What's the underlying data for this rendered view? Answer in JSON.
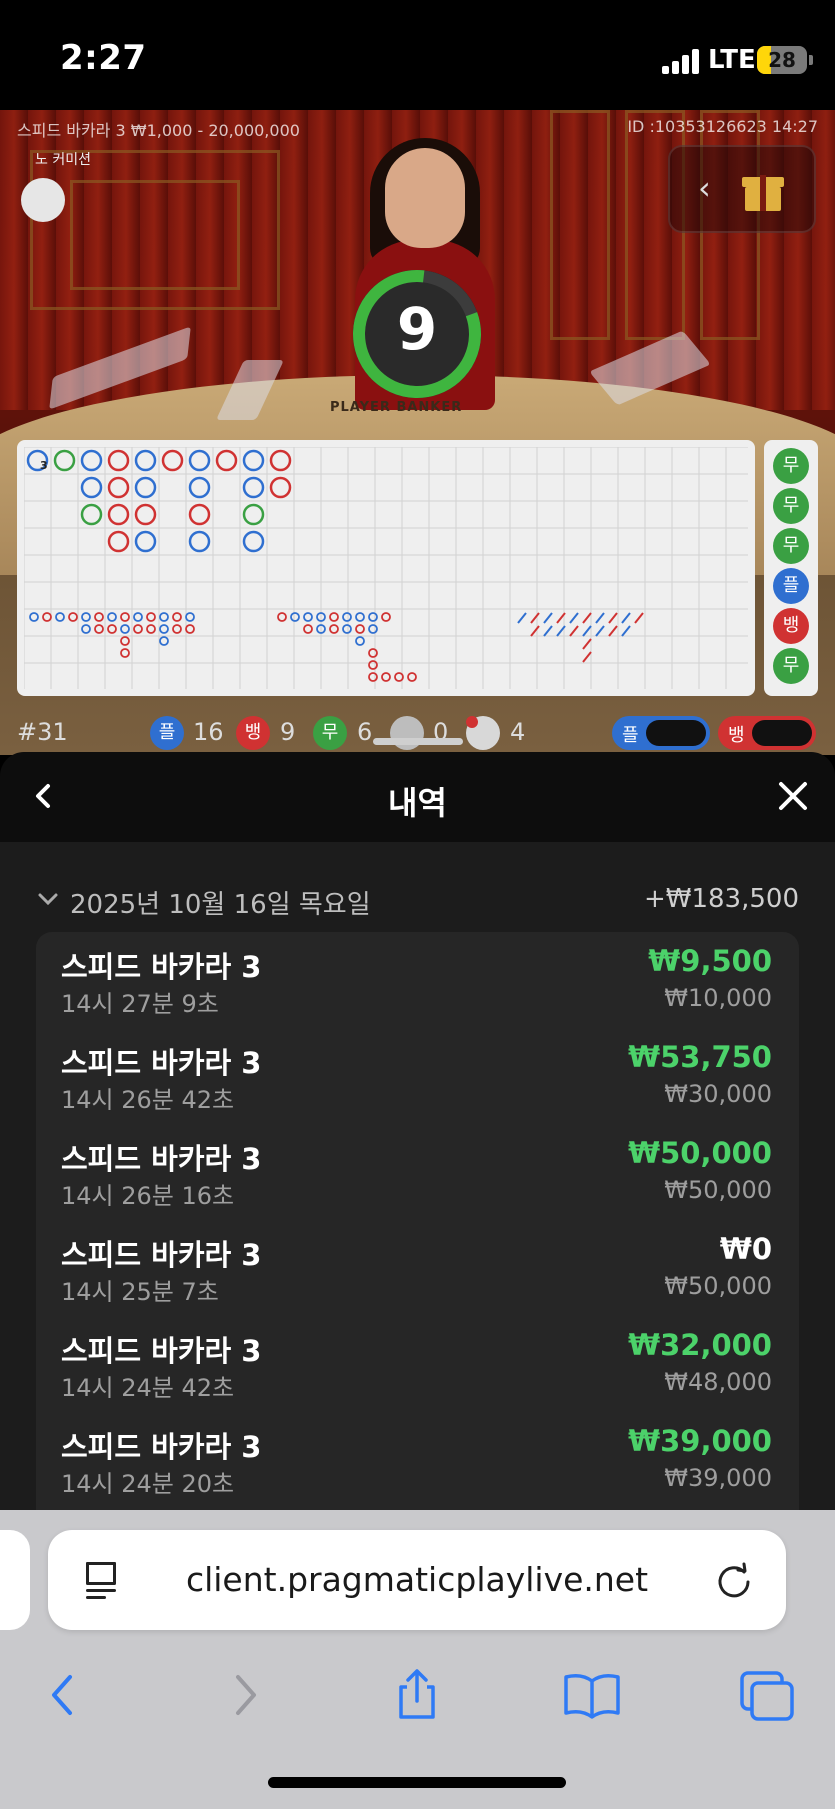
{
  "status_bar": {
    "time": "2:27",
    "network": "LTE",
    "battery": "28",
    "battery_level": 0.28
  },
  "game": {
    "title": "스피드 바카라 3 ₩1,000 - 20,000,000",
    "id": "ID :10353126623 14:27",
    "no_commission_label": "노 커미션",
    "timer": "9",
    "table_label": "PLAYER  BANKER",
    "bead_road_first_label": "3"
  },
  "side_road": [
    {
      "label": "무",
      "color": "#3aa043"
    },
    {
      "label": "무",
      "color": "#3aa043"
    },
    {
      "label": "무",
      "color": "#3aa043"
    },
    {
      "label": "플",
      "color": "#2f6fd0"
    },
    {
      "label": "뱅",
      "color": "#d03232"
    },
    {
      "label": "무",
      "color": "#3aa043"
    }
  ],
  "stats": {
    "round": "#31",
    "player_label": "플",
    "player_count": "16",
    "banker_label": "뱅",
    "banker_count": "9",
    "tie_label": "무",
    "tie_count": "6",
    "player_pair_count": "0",
    "banker_pair_count": "4",
    "player_predict_label": "플",
    "banker_predict_label": "뱅"
  },
  "history": {
    "title": "내역",
    "date": "2025년 10월 16일 목요일",
    "date_total": "+₩183,500",
    "items": [
      {
        "game": "스피드 바카라 3",
        "time": "14시 27분 9초",
        "win": "₩9,500",
        "stake": "₩10,000",
        "win_color": "#4cd26a"
      },
      {
        "game": "스피드 바카라 3",
        "time": "14시 26분 42초",
        "win": "₩53,750",
        "stake": "₩30,000",
        "win_color": "#4cd26a"
      },
      {
        "game": "스피드 바카라 3",
        "time": "14시 26분 16초",
        "win": "₩50,000",
        "stake": "₩50,000",
        "win_color": "#4cd26a"
      },
      {
        "game": "스피드 바카라 3",
        "time": "14시 25분 7초",
        "win": "₩0",
        "stake": "₩50,000",
        "win_color": "#ffffff"
      },
      {
        "game": "스피드 바카라 3",
        "time": "14시 24분 42초",
        "win": "₩32,000",
        "stake": "₩48,000",
        "win_color": "#4cd26a"
      },
      {
        "game": "스피드 바카라 3",
        "time": "14시 24분 20초",
        "win": "₩39,000",
        "stake": "₩39,000",
        "win_color": "#4cd26a"
      }
    ]
  },
  "browser": {
    "url": "client.pragmaticplaylive.net"
  },
  "colors": {
    "player": "#2f6fd0",
    "banker": "#d03232",
    "tie": "#3aa043",
    "win": "#4cd26a"
  },
  "icons": {
    "back": "chevron-left-icon",
    "close": "close-icon",
    "gift": "gift-icon",
    "reader": "reader-icon",
    "reload": "reload-icon",
    "share": "share-icon",
    "bookmarks": "book-icon",
    "tabs": "tabs-icon"
  }
}
